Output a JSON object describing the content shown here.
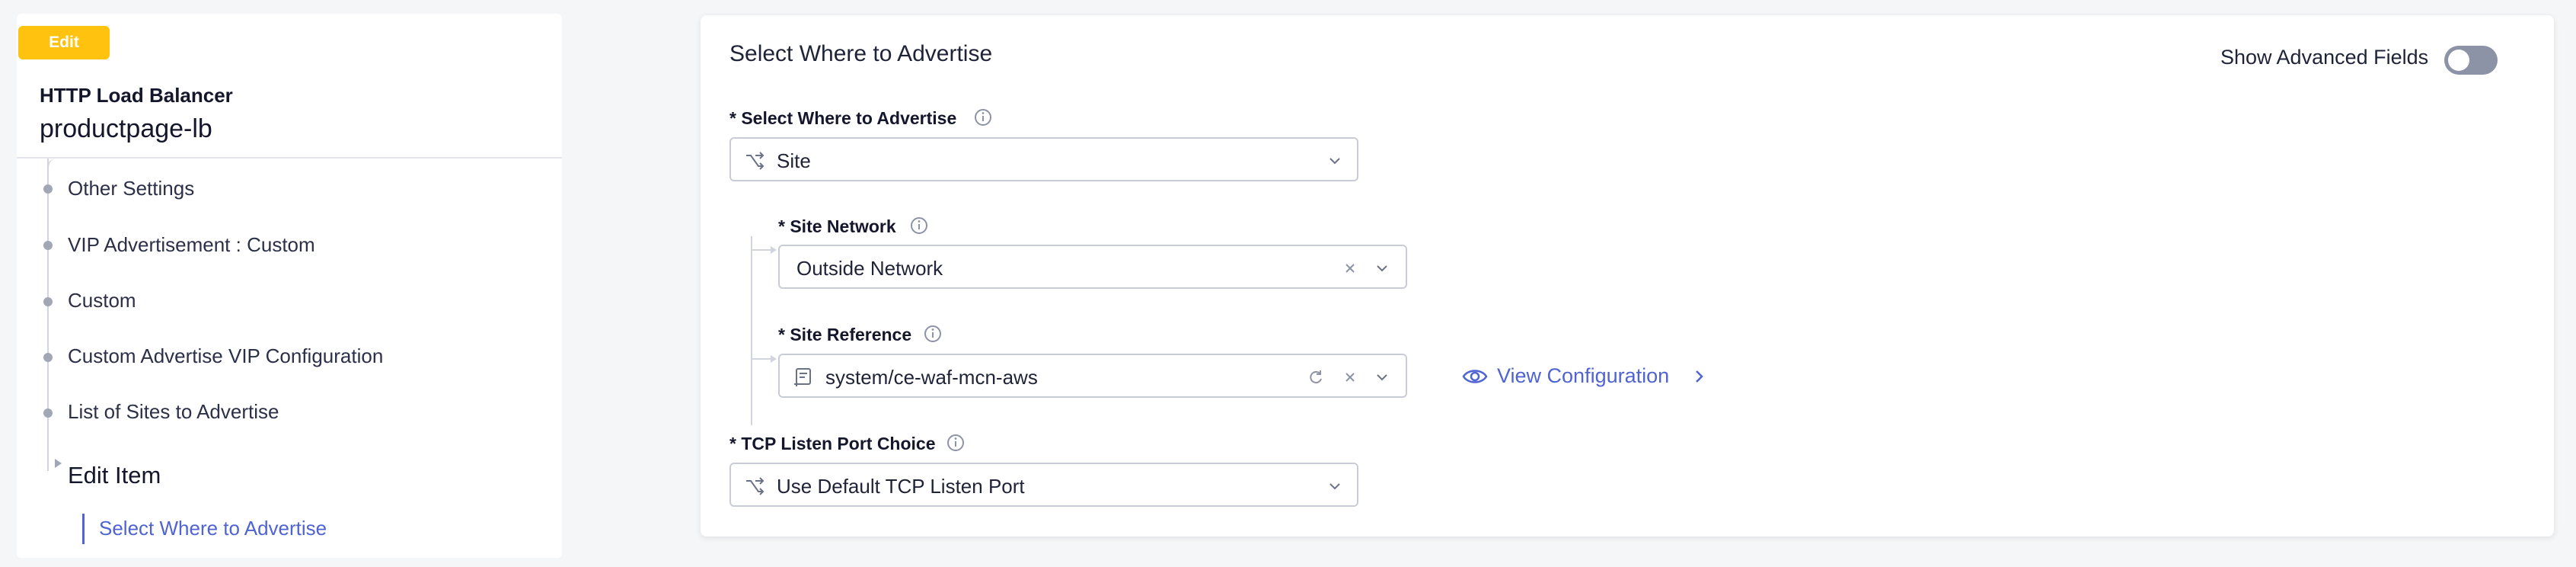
{
  "sidebar": {
    "badge": "Edit",
    "object_type": "HTTP Load Balancer",
    "object_name": "productpage-lb",
    "nav_items": [
      {
        "label": "Other Settings"
      },
      {
        "label": "VIP Advertisement : Custom"
      },
      {
        "label": "Custom"
      },
      {
        "label": "Custom Advertise VIP Configuration"
      },
      {
        "label": "List of Sites to Advertise"
      }
    ],
    "current_item": "Edit Item",
    "current_subitem": "Select Where to Advertise"
  },
  "main": {
    "title": "Select Where to Advertise",
    "advanced_toggle": {
      "label": "Show Advanced Fields",
      "on": false
    },
    "fields": {
      "where": {
        "label": "* Select Where to Advertise",
        "value": "Site",
        "icon": "branch-icon"
      },
      "site_network": {
        "label": "* Site Network",
        "value": "Outside Network"
      },
      "site_reference": {
        "label": "* Site Reference",
        "value": "system/ce-waf-mcn-aws",
        "icon": "document-icon"
      },
      "view_configuration": "View Configuration",
      "tcp_port": {
        "label": "* TCP Listen Port Choice",
        "value": "Use Default TCP Listen Port",
        "icon": "branch-icon"
      }
    }
  },
  "colors": {
    "badge": "#ffc30f",
    "accent": "#4f63d2",
    "toggle_off": "#8d93a6"
  }
}
